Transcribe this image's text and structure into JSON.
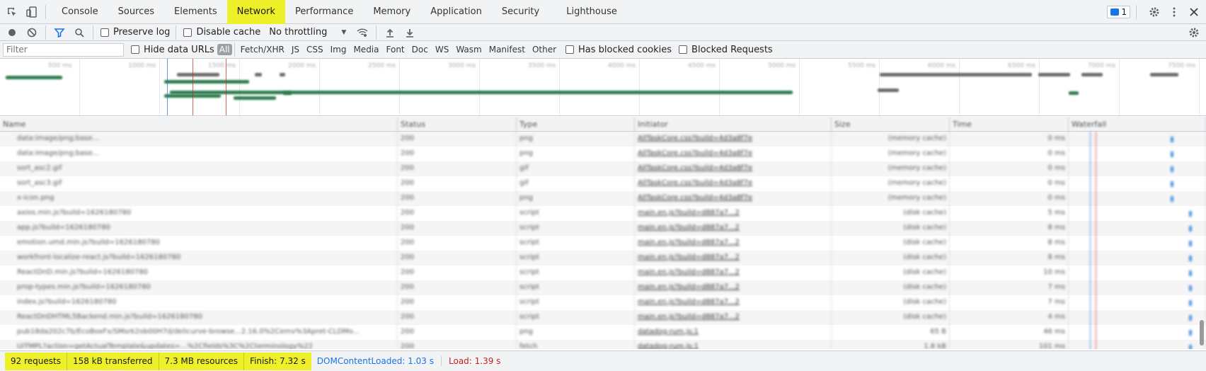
{
  "tabs": [
    "Console",
    "Sources",
    "Elements",
    "Network",
    "Performance",
    "Memory",
    "Application",
    "Security",
    "Lighthouse"
  ],
  "active_tab": "Network",
  "issues_count": "1",
  "toolbar": {
    "preserve_log": "Preserve log",
    "disable_cache": "Disable cache",
    "throttling": "No throttling"
  },
  "filter": {
    "placeholder": "Filter",
    "hide_data_urls": "Hide data URLs",
    "types": [
      "All",
      "Fetch/XHR",
      "JS",
      "CSS",
      "Img",
      "Media",
      "Font",
      "Doc",
      "WS",
      "Wasm",
      "Manifest",
      "Other"
    ],
    "has_blocked_cookies": "Has blocked cookies",
    "blocked_requests": "Blocked Requests"
  },
  "overview": {
    "tick_labels": [
      "500 ms",
      "1000 ms",
      "1500 ms",
      "2000 ms",
      "2500 ms",
      "3000 ms",
      "3500 ms",
      "4000 ms",
      "4500 ms",
      "5000 ms",
      "5500 ms",
      "6000 ms",
      "6500 ms",
      "7000 ms",
      "7500 ms"
    ]
  },
  "table": {
    "columns": [
      "Name",
      "Status",
      "Type",
      "Initiator",
      "Size",
      "Time",
      "Waterfall"
    ],
    "rows": [
      {
        "name": "data:image/png;base...",
        "status": "200",
        "type": "png",
        "initiator": "AllTaskCore.css?build=4d3a8f7e",
        "size": "(memory cache)",
        "time": "0 ms"
      },
      {
        "name": "data:image/png;base...",
        "status": "200",
        "type": "png",
        "initiator": "AllTaskCore.css?build=4d3a8f7e",
        "size": "(memory cache)",
        "time": "0 ms"
      },
      {
        "name": "sort_asc2.gif",
        "status": "200",
        "type": "gif",
        "initiator": "AllTaskCore.css?build=4d3a8f7e",
        "size": "(memory cache)",
        "time": "0 ms"
      },
      {
        "name": "sort_asc3.gif",
        "status": "200",
        "type": "gif",
        "initiator": "AllTaskCore.css?build=4d3a8f7e",
        "size": "(memory cache)",
        "time": "0 ms"
      },
      {
        "name": "x-icon.png",
        "status": "200",
        "type": "png",
        "initiator": "AllTaskCore.css?build=4d3a8f7e",
        "size": "(memory cache)",
        "time": "0 ms"
      },
      {
        "name": "axios.min.js?build=1626180780",
        "status": "200",
        "type": "script",
        "initiator": "main.en.js?build=d887a7...2",
        "size": "(disk cache)",
        "time": "5 ms"
      },
      {
        "name": "app.js?build=1626180780",
        "status": "200",
        "type": "script",
        "initiator": "main.en.js?build=d887a7...2",
        "size": "(disk cache)",
        "time": "8 ms"
      },
      {
        "name": "emotion.umd.min.js?build=1626180780",
        "status": "200",
        "type": "script",
        "initiator": "main.en.js?build=d887a7...2",
        "size": "(disk cache)",
        "time": "8 ms"
      },
      {
        "name": "workfront-localize-react.js?build=1626180780",
        "status": "200",
        "type": "script",
        "initiator": "main.en.js?build=d887a7...2",
        "size": "(disk cache)",
        "time": "8 ms"
      },
      {
        "name": "ReactDnD.min.js?build=1626180780",
        "status": "200",
        "type": "script",
        "initiator": "main.en.js?build=d887a7...2",
        "size": "(disk cache)",
        "time": "10 ms"
      },
      {
        "name": "prop-types.min.js?build=1626180780",
        "status": "200",
        "type": "script",
        "initiator": "main.en.js?build=d887a7...2",
        "size": "(disk cache)",
        "time": "7 ms"
      },
      {
        "name": "index.js?build=1626180780",
        "status": "200",
        "type": "script",
        "initiator": "main.en.js?build=d887a7...2",
        "size": "(disk cache)",
        "time": "7 ms"
      },
      {
        "name": "ReactDnDHTML5Backend.min.js?build=1626180780",
        "status": "200",
        "type": "script",
        "initiator": "main.en.js?build=d887a7...2",
        "size": "(disk cache)",
        "time": "4 ms"
      },
      {
        "name": "pub18da202c7b/EcoBoxFx/SMsrk2ob00H7d/delicurve-browse...2.16.0%2Cemv%3Apret-CLDMo...",
        "status": "200",
        "type": "png",
        "initiator": "datadog-rum.js:1",
        "size": "65 B",
        "time": "46 ms"
      },
      {
        "name": "UiTMPL?action=getActualTemplate&updates=...%2Cfields%3C%2Cterminology%22",
        "status": "200",
        "type": "fetch",
        "initiator": "datadog-rum.js:1",
        "size": "1.8 kB",
        "time": "101 ms"
      }
    ]
  },
  "status": {
    "requests": "92 requests",
    "transferred": "158 kB transferred",
    "resources": "7.3 MB resources",
    "finish": "Finish: 7.32 s",
    "dom_content_loaded": "DOMContentLoaded: 1.03 s",
    "load": "Load: 1.39 s"
  },
  "colors": {
    "highlight": "#eef02a",
    "dcl_blue": "#1a73e8",
    "load_red": "#c5221f",
    "bar_green": "#2e7d4f",
    "bar_gray": "#6b6b6b"
  }
}
